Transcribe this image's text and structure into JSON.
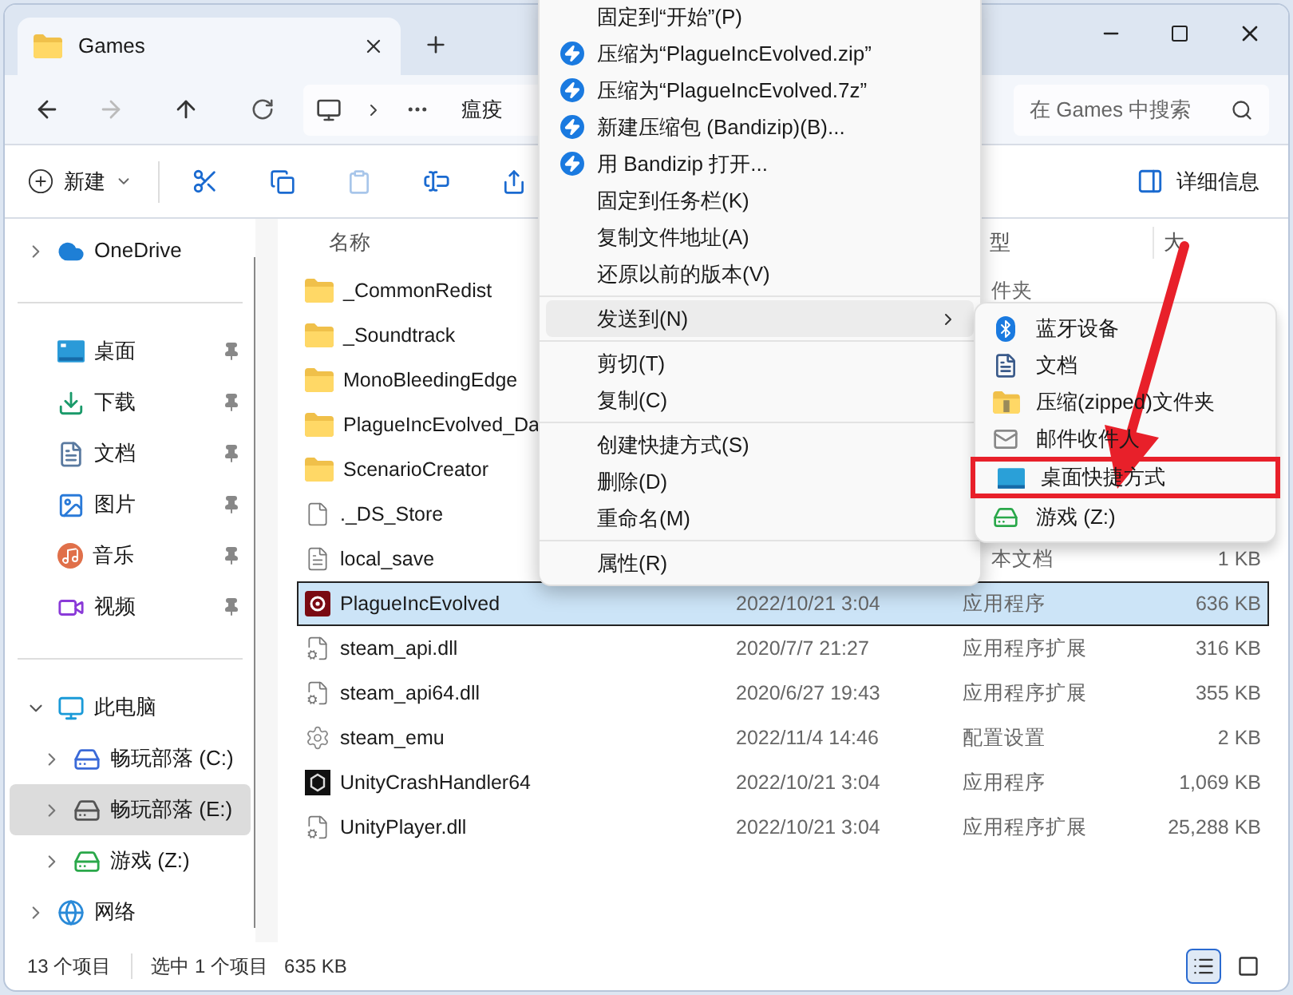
{
  "tab": {
    "title": "Games",
    "selected": true
  },
  "address": {
    "crumb": "瘟疫",
    "search_placeholder": "在 Games 中搜索"
  },
  "toolbar": {
    "new_label": "新建",
    "details_label": "详细信息",
    "paste_disabled": true
  },
  "sidebar": {
    "groups": [
      {
        "items": [
          {
            "label": "OneDrive",
            "kind": "cloud",
            "expanded": false,
            "selected": false
          }
        ]
      },
      {
        "items": [
          {
            "label": "桌面",
            "kind": "desktop",
            "pinned": true,
            "selected": false
          },
          {
            "label": "下载",
            "kind": "download",
            "pinned": true,
            "selected": false
          },
          {
            "label": "文档",
            "kind": "document",
            "pinned": true,
            "selected": false
          },
          {
            "label": "图片",
            "kind": "image",
            "pinned": true,
            "selected": false
          },
          {
            "label": "音乐",
            "kind": "music",
            "pinned": true,
            "selected": false
          },
          {
            "label": "视频",
            "kind": "video",
            "pinned": true,
            "selected": false
          }
        ]
      },
      {
        "items": [
          {
            "label": "此电脑",
            "kind": "pc",
            "expanded": true,
            "selected": false,
            "children": [
              {
                "label": "畅玩部落 (C:)",
                "kind": "sysdrive",
                "expanded": false,
                "selected": false
              },
              {
                "label": "畅玩部落 (E:)",
                "kind": "drive",
                "expanded": false,
                "selected": true
              },
              {
                "label": "游戏 (Z:)",
                "kind": "netdrive",
                "expanded": false,
                "selected": false
              }
            ]
          },
          {
            "label": "网络",
            "kind": "network",
            "expanded": false,
            "selected": false
          }
        ]
      }
    ]
  },
  "table": {
    "columns": [
      {
        "label": "名称"
      },
      {
        "label": "型",
        "clipped": true
      },
      {
        "label": "大"
      }
    ],
    "rows": [
      {
        "name": "_CommonRedist",
        "kind": "folder",
        "type": "件夹",
        "type_clipped": true,
        "selected": false
      },
      {
        "name": "_Soundtrack",
        "kind": "folder",
        "selected": false
      },
      {
        "name": "MonoBleedingEdge",
        "kind": "folder",
        "selected": false
      },
      {
        "name": "PlagueIncEvolved_Da",
        "kind": "folder",
        "selected": false
      },
      {
        "name": "ScenarioCreator",
        "kind": "folder",
        "selected": false
      },
      {
        "name": "._DS_Store",
        "kind": "file",
        "selected": false
      },
      {
        "name": "local_save",
        "kind": "text",
        "type": "本文档",
        "type_clipped": true,
        "size": "1 KB",
        "selected": false
      },
      {
        "name": "PlagueIncEvolved",
        "kind": "app",
        "date": "2022/10/21 3:04",
        "type": "应用程序",
        "type_clipped": false,
        "size": "636 KB",
        "selected": true
      },
      {
        "name": "steam_api.dll",
        "kind": "dll",
        "date": "2020/7/7 21:27",
        "type": "应用程序扩展",
        "type_clipped": false,
        "size": "316 KB",
        "selected": false
      },
      {
        "name": "steam_api64.dll",
        "kind": "dll",
        "date": "2020/6/27 19:43",
        "type": "应用程序扩展",
        "type_clipped": false,
        "size": "355 KB",
        "selected": false
      },
      {
        "name": "steam_emu",
        "kind": "config",
        "date": "2022/11/4 14:46",
        "type": "配置设置",
        "type_clipped": false,
        "size": "2 KB",
        "selected": false
      },
      {
        "name": "UnityCrashHandler64",
        "kind": "unity",
        "date": "2022/10/21 3:04",
        "type": "应用程序",
        "type_clipped": false,
        "size": "1,069 KB",
        "selected": false
      },
      {
        "name": "UnityPlayer.dll",
        "kind": "dll",
        "date": "2022/10/21 3:04",
        "type": "应用程序扩展",
        "type_clipped": false,
        "size": "25,288 KB",
        "selected": false
      }
    ]
  },
  "status_bar": {
    "count": "13 个项目",
    "selection": "选中 1 个项目",
    "size": "635 KB",
    "views": [
      {
        "kind": "details",
        "selected": true
      },
      {
        "kind": "tiles",
        "selected": false
      }
    ]
  },
  "context_menu": {
    "groups": [
      [
        {
          "label": "固定到“开始”(P)",
          "kind": "plain"
        },
        {
          "label": "压缩为“PlagueIncEvolved.zip”",
          "kind": "bandizip"
        },
        {
          "label": "压缩为“PlagueIncEvolved.7z”",
          "kind": "bandizip"
        },
        {
          "label": "新建压缩包 (Bandizip)(B)...",
          "kind": "bandizip"
        },
        {
          "label": "用 Bandizip 打开...",
          "kind": "bandizip"
        },
        {
          "label": "固定到任务栏(K)",
          "kind": "plain"
        },
        {
          "label": "复制文件地址(A)",
          "kind": "plain"
        },
        {
          "label": "还原以前的版本(V)",
          "kind": "plain"
        }
      ],
      [
        {
          "label": "发送到(N)",
          "kind": "submenu",
          "selected": true
        }
      ],
      [
        {
          "label": "剪切(T)",
          "kind": "plain"
        },
        {
          "label": "复制(C)",
          "kind": "plain"
        }
      ],
      [
        {
          "label": "创建快捷方式(S)",
          "kind": "plain"
        },
        {
          "label": "删除(D)",
          "kind": "plain"
        },
        {
          "label": "重命名(M)",
          "kind": "plain"
        }
      ],
      [
        {
          "label": "属性(R)",
          "kind": "plain"
        }
      ]
    ]
  },
  "submenu": {
    "items": [
      {
        "label": "蓝牙设备",
        "kind": "bluetooth",
        "highlighted": false
      },
      {
        "label": "文档",
        "kind": "document",
        "highlighted": false
      },
      {
        "label": "压缩(zipped)文件夹",
        "kind": "zip",
        "highlighted": false
      },
      {
        "label": "邮件收件人",
        "kind": "mail",
        "highlighted": false
      },
      {
        "label": "桌面快捷方式",
        "kind": "desktop",
        "highlighted": true
      },
      {
        "label": "游戏 (Z:)",
        "kind": "netdrive",
        "highlighted": false
      }
    ]
  },
  "annotation": {
    "arrow": true
  }
}
